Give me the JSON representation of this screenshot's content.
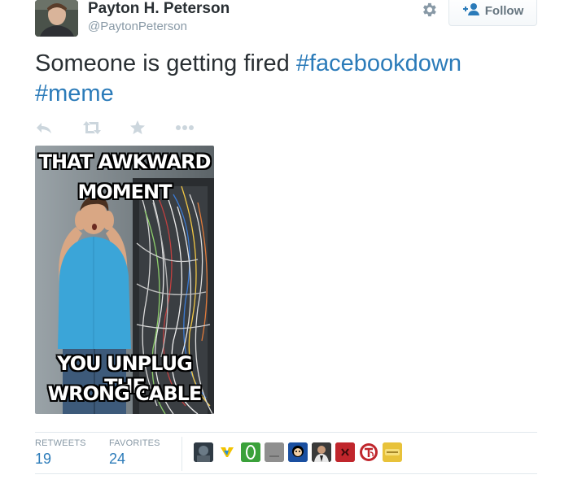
{
  "author": {
    "name": "Payton H. Peterson",
    "handle": "@PaytonPeterson"
  },
  "header": {
    "settings_icon": "gear-icon",
    "follow_label": "Follow",
    "follow_icon": "add-user-icon"
  },
  "tweet": {
    "text": "Someone is getting fired",
    "hashtag_1": "#facebookdown",
    "hashtag_2": "#meme"
  },
  "actions": [
    "reply-icon",
    "retweet-icon",
    "favorite-icon",
    "more-icon"
  ],
  "media": {
    "caption_top_line1": "THAT AWKWARD",
    "caption_top_line2": "MOMENT",
    "caption_bottom_line1": "YOU UNPLUG THE",
    "caption_bottom_line2": "WRONG CABLE"
  },
  "stats": {
    "retweets_label": "RETWEETS",
    "retweets_value": "19",
    "favorites_label": "FAVORITES",
    "favorites_value": "24"
  },
  "favoriters": [
    {
      "name": "favoriter-1",
      "color": "#2f3a44"
    },
    {
      "name": "favoriter-2",
      "color": "#ffffff"
    },
    {
      "name": "favoriter-3",
      "color": "#3aa13a"
    },
    {
      "name": "favoriter-4",
      "color": "#8a8a8a"
    },
    {
      "name": "favoriter-5",
      "color": "#1a4fa0"
    },
    {
      "name": "favoriter-6",
      "color": "#2a2a2a"
    },
    {
      "name": "favoriter-7",
      "color": "#c0262c"
    },
    {
      "name": "favoriter-8",
      "color": "#ffffff"
    },
    {
      "name": "favoriter-9",
      "color": "#e8c23a"
    }
  ],
  "colors": {
    "link": "#2b7bb9",
    "muted": "#8899a6",
    "text": "#292f33",
    "border": "#e1e8ed"
  }
}
